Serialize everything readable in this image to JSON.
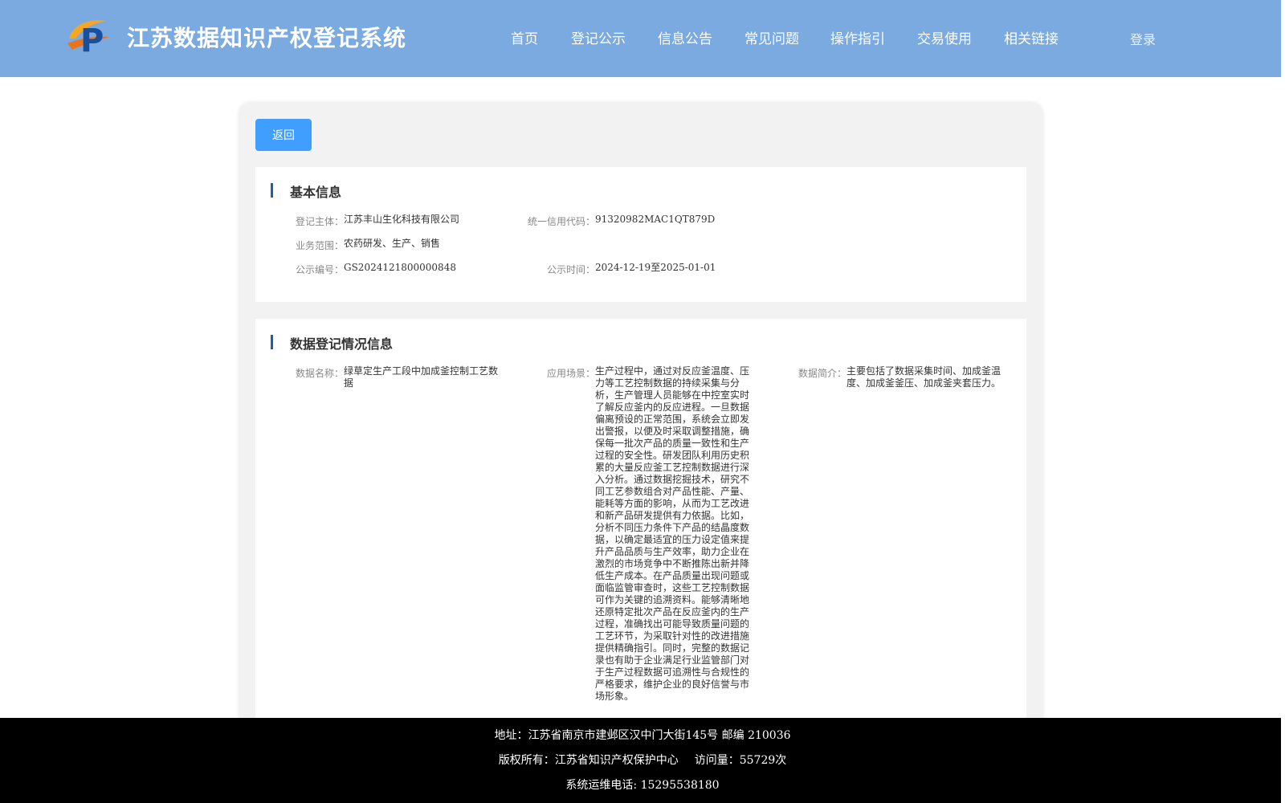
{
  "header": {
    "title": "江苏数据知识产权登记系统",
    "nav": [
      "首页",
      "登记公示",
      "信息公告",
      "常见问题",
      "操作指引",
      "交易使用",
      "相关链接"
    ],
    "login": "登录",
    "colors": {
      "header_bg": "#7aaadf",
      "accent": "#409eff"
    }
  },
  "back_label": "返回",
  "basic": {
    "title": "基本信息",
    "subject_label": "登记主体：",
    "subject": "江苏丰山生化科技有限公司",
    "credit_label": "统一信用代码：",
    "credit": "91320982MAC1QT879D",
    "scope_label": "业务范围：",
    "scope": "农药研发、生产、销售",
    "notice_no_label": "公示编号：",
    "notice_no": "GS2024121800000848",
    "notice_time_label": "公示时间：",
    "notice_time": "2024-12-19至2025-01-01"
  },
  "data_info": {
    "title": "数据登记情况信息",
    "name_label": "数据名称：",
    "name": "绿草定生产工段中加成釜控制工艺数据",
    "scenario_label": "应用场景：",
    "scenario": "生产过程中，通过对反应釜温度、压力等工艺控制数据的持续采集与分析，生产管理人员能够在中控室实时了解反应釜内的反应进程。一旦数据偏离预设的正常范围，系统会立即发出警报，以便及时采取调整措施，确保每一批次产品的质量一致性和生产过程的安全性。研发团队利用历史积累的大量反应釜工艺控制数据进行深入分析。通过数据挖掘技术，研究不同工艺参数组合对产品性能、产量、能耗等方面的影响，从而为工艺改进和新产品研发提供有力依据。比如，分析不同压力条件下产品的结晶度数据，以确定最适宜的压力设定值来提升产品品质与生产效率，助力企业在激烈的市场竞争中不断推陈出新并降低生产成本。在产品质量出现问题或面临监管审查时，这些工艺控制数据可作为关键的追溯资料。能够清晰地还原特定批次产品在反应釜内的生产过程，准确找出可能导致质量问题的工艺环节，为采取针对性的改进措施提供精确指引。同时，完整的数据记录也有助于企业满足行业监管部门对于生产过程数据可追溯性与合规性的严格要求，维护企业的良好信誉与市场形象。",
    "intro_label": "数据简介：",
    "intro": "主要包括了数据采集时间、加成釜温度、加成釜釜压、加成釜夹套压力。"
  },
  "footer": {
    "address": "地址：江苏省南京市建邺区汉中门大街145号 邮编 210036",
    "copyright": "版权所有：江苏省知识产权保护中心",
    "visits": "访问量：55729次",
    "hotline": "系统运维电话: 15295538180"
  }
}
